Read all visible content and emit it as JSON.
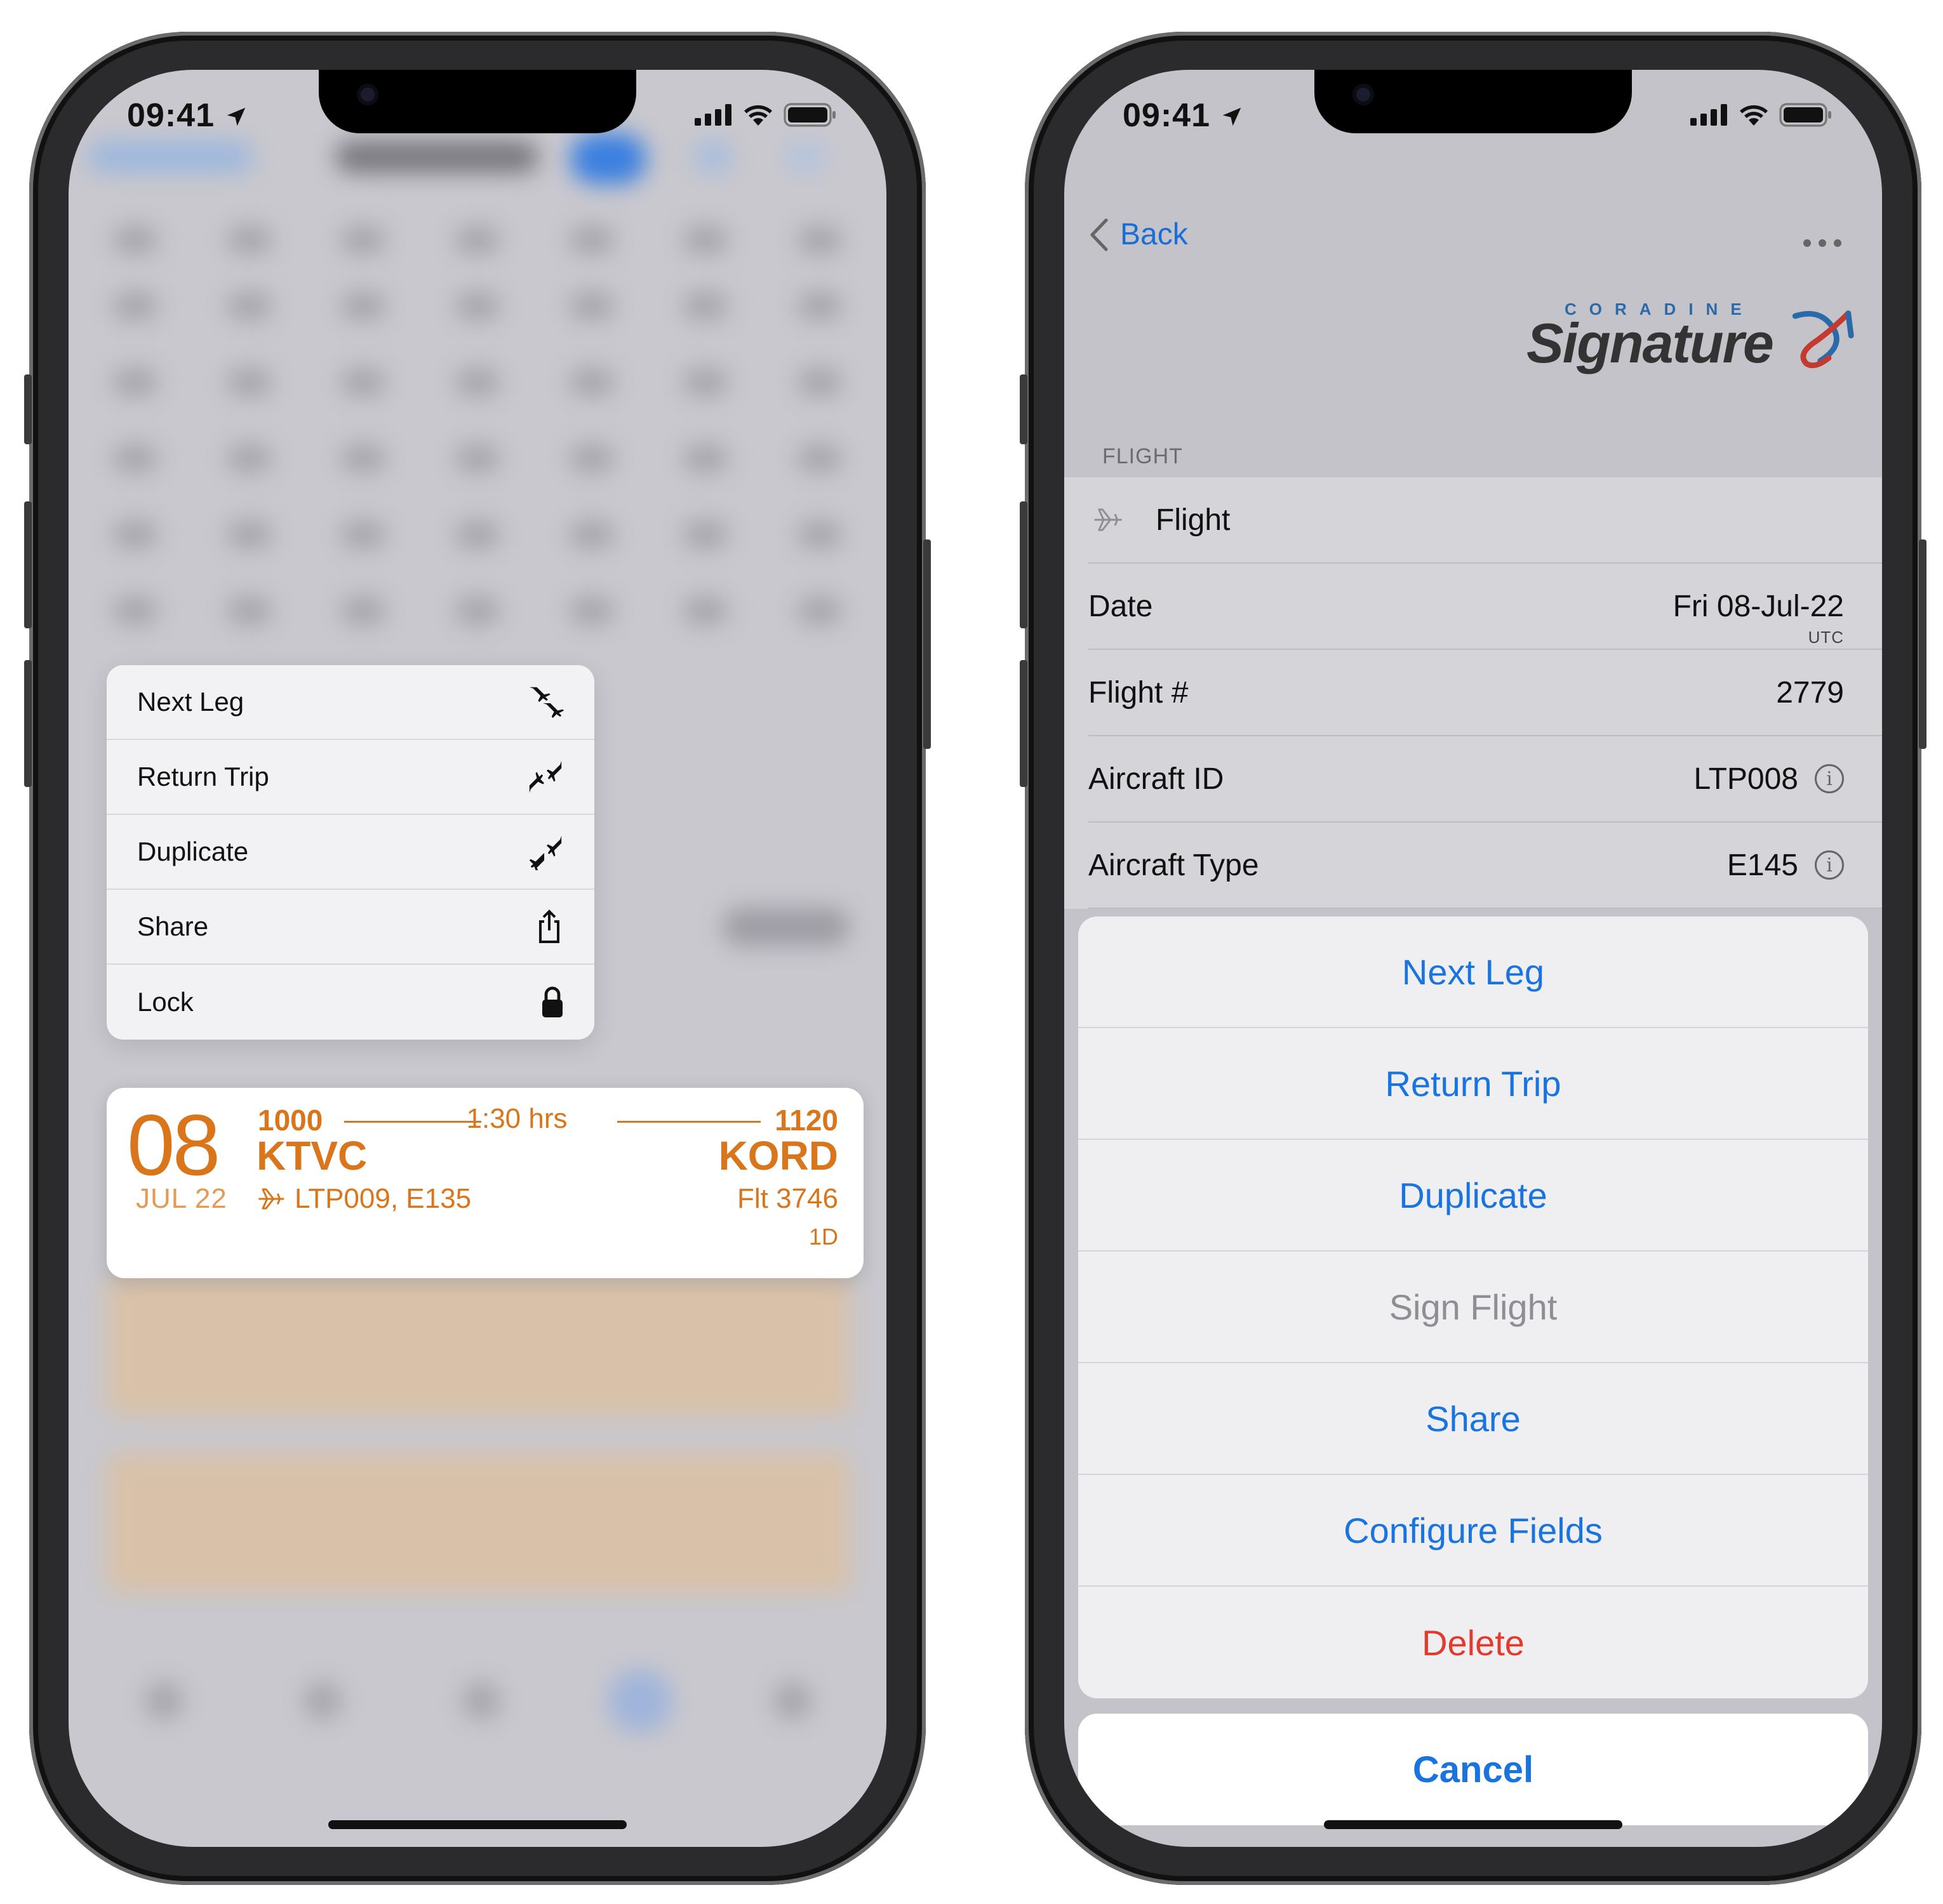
{
  "status": {
    "time": "09:41"
  },
  "left": {
    "context_menu": {
      "items": [
        {
          "label": "Next Leg",
          "icon": "next-leg-icon"
        },
        {
          "label": "Return Trip",
          "icon": "return-trip-icon"
        },
        {
          "label": "Duplicate",
          "icon": "duplicate-icon"
        },
        {
          "label": "Share",
          "icon": "share-icon"
        },
        {
          "label": "Lock",
          "icon": "lock-icon"
        }
      ]
    },
    "flight_card": {
      "day": "08",
      "month_year": "JUL 22",
      "departure_time": "1000",
      "departure_airport": "KTVC",
      "duration": "1:30 hrs",
      "arrival_time": "1120",
      "arrival_airport": "KORD",
      "aircraft": "LTP009, E135",
      "flight_number": "Flt 3746",
      "day_offset": "1D",
      "accent_color": "#d9751a"
    }
  },
  "right": {
    "nav": {
      "back_label": "Back",
      "more_icon": "ellipsis-icon"
    },
    "logo": {
      "small_text": "CORADINE",
      "big_text": "Signature"
    },
    "section_header": "FLIGHT",
    "rows": {
      "flight_title": "Flight",
      "date_label": "Date",
      "date_value": "Fri 08-Jul-22",
      "date_tz": "UTC",
      "flight_no_label": "Flight #",
      "flight_no_value": "2779",
      "aircraft_id_label": "Aircraft ID",
      "aircraft_id_value": "LTP008",
      "aircraft_type_label": "Aircraft Type",
      "aircraft_type_value": "E145"
    },
    "action_sheet": {
      "items": [
        {
          "label": "Next Leg"
        },
        {
          "label": "Return Trip"
        },
        {
          "label": "Duplicate"
        },
        {
          "label": "Sign Flight"
        },
        {
          "label": "Share"
        },
        {
          "label": "Configure Fields"
        },
        {
          "label": "Delete"
        }
      ],
      "cancel_label": "Cancel",
      "tint_color": "#1a74e0",
      "destructive_color": "#e23b2e"
    }
  }
}
